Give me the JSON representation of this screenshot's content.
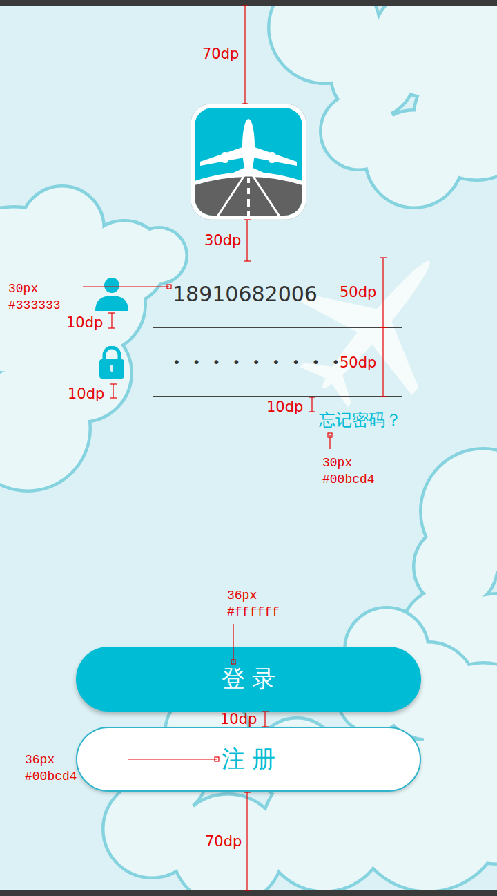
{
  "login_form": {
    "username": "18910682006",
    "password": "•••••••••",
    "forgot_password": "忘记密码？"
  },
  "buttons": [
    {
      "label": "登 录",
      "kind": "filled"
    },
    {
      "label": "注 册",
      "kind": "outline"
    }
  ],
  "annotations": [
    {
      "kind": "dp",
      "lines": [
        "70dp"
      ]
    },
    {
      "kind": "dp",
      "lines": [
        "30dp"
      ]
    },
    {
      "kind": "px",
      "lines": [
        "30px",
        "#333333"
      ]
    },
    {
      "kind": "dp",
      "lines": [
        "10dp"
      ]
    },
    {
      "kind": "dp",
      "lines": [
        "50dp"
      ]
    },
    {
      "kind": "dp",
      "lines": [
        "50dp"
      ]
    },
    {
      "kind": "dp",
      "lines": [
        "10dp"
      ]
    },
    {
      "kind": "dp",
      "lines": [
        "10dp"
      ]
    },
    {
      "kind": "px",
      "lines": [
        "30px",
        "#00bcd4"
      ]
    },
    {
      "kind": "px",
      "lines": [
        "36px",
        "#ffffff"
      ]
    },
    {
      "kind": "dp",
      "lines": [
        "10dp"
      ]
    },
    {
      "kind": "px",
      "lines": [
        "36px",
        "#00bcd4"
      ]
    },
    {
      "kind": "dp",
      "lines": [
        "70dp"
      ]
    }
  ]
}
